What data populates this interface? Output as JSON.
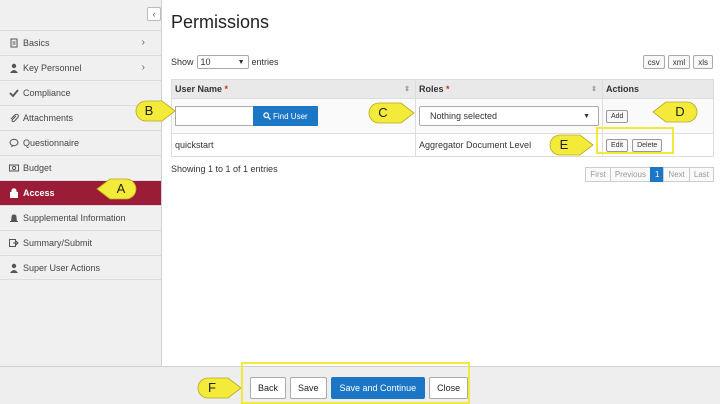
{
  "sidebar": {
    "items": [
      {
        "label": "Basics",
        "icon": "document-icon",
        "chevron": "›"
      },
      {
        "label": "Key Personnel",
        "icon": "person-icon",
        "chevron": "›"
      },
      {
        "label": "Compliance",
        "icon": "check-icon",
        "chevron": ""
      },
      {
        "label": "Attachments",
        "icon": "paperclip-icon",
        "chevron": ""
      },
      {
        "label": "Questionnaire",
        "icon": "chat-icon",
        "chevron": ""
      },
      {
        "label": "Budget",
        "icon": "budget-icon",
        "chevron": ""
      },
      {
        "label": "Access",
        "icon": "lock-icon",
        "chevron": ""
      },
      {
        "label": "Supplemental Information",
        "icon": "bell-icon",
        "chevron": ""
      },
      {
        "label": "Summary/Submit",
        "icon": "submit-icon",
        "chevron": ""
      },
      {
        "label": "Super User Actions",
        "icon": "super-user-icon",
        "chevron": ""
      }
    ],
    "collapse_glyph": "‹",
    "active_index": 6
  },
  "main": {
    "title": "Permissions",
    "show_label": "Show",
    "entries_value": "10",
    "entries_label": "entries",
    "caret": "▼",
    "exports": [
      "csv",
      "xml",
      "xls"
    ],
    "table": {
      "col_user": "User Name",
      "col_roles": "Roles",
      "col_actions": "Actions",
      "required_mark": "*",
      "find_user_label": "Find User",
      "roles_placeholder": "Nothing selected",
      "add_label": "Add",
      "rows": [
        {
          "user": "quickstart",
          "role": "Aggregator Document Level",
          "edit": "Edit",
          "delete": "Delete"
        }
      ]
    },
    "info": "Showing 1 to 1 of 1 entries",
    "pager": [
      "First",
      "Previous",
      "1",
      "Next",
      "Last"
    ]
  },
  "footer": {
    "back": "Back",
    "save": "Save",
    "save_continue": "Save and Continue",
    "close": "Close"
  },
  "annotations": [
    "A",
    "B",
    "C",
    "D",
    "E",
    "F"
  ],
  "colors": {
    "active_item": "#9b1c36",
    "primary_button": "#1b76c6",
    "callout_fill": "#f4ea3a",
    "required": "#c0392b"
  }
}
